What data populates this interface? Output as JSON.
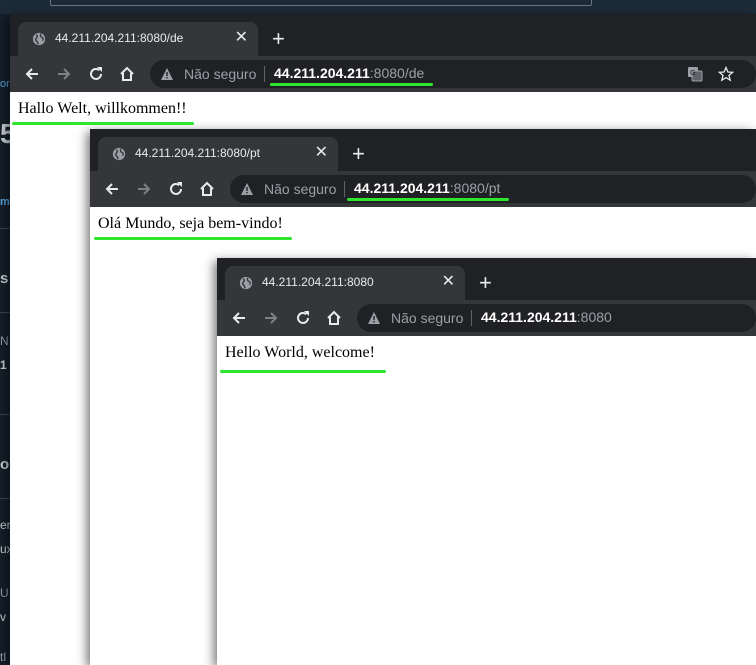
{
  "colors": {
    "highlight": "#2ee62e",
    "tabstrip": "#202124",
    "tab": "#35363a",
    "omnibox": "#202124"
  },
  "background_app": {
    "fragments": [
      "or",
      "5",
      "m",
      "s",
      "N",
      "1",
      "or",
      "er",
      "ux",
      "U",
      "v",
      "tl"
    ]
  },
  "windows": [
    {
      "tab_title": "44.211.204.211:8080/de",
      "close_glyph": "✕",
      "newtab_glyph": "+",
      "security_label": "Não seguro",
      "url_host": "44.211.204.211",
      "url_rest": ":8080/de",
      "page_text": "Hallo Welt, willkommen!!",
      "icons": [
        "globe-icon",
        "close-icon",
        "plus-icon",
        "back-icon",
        "forward-icon",
        "reload-icon",
        "home-icon",
        "warning-icon",
        "translate-icon",
        "star-icon"
      ]
    },
    {
      "tab_title": "44.211.204.211:8080/pt",
      "close_glyph": "✕",
      "newtab_glyph": "+",
      "security_label": "Não seguro",
      "url_host": "44.211.204.211",
      "url_rest": ":8080/pt",
      "page_text": "Olá Mundo, seja bem-vindo!",
      "icons": [
        "globe-icon",
        "close-icon",
        "plus-icon",
        "back-icon",
        "forward-icon",
        "reload-icon",
        "home-icon",
        "warning-icon"
      ]
    },
    {
      "tab_title": "44.211.204.211:8080",
      "close_glyph": "✕",
      "newtab_glyph": "+",
      "security_label": "Não seguro",
      "url_host": "44.211.204.211",
      "url_rest": ":8080",
      "page_text": "Hello World, welcome!",
      "icons": [
        "globe-icon",
        "close-icon",
        "plus-icon",
        "back-icon",
        "forward-icon",
        "reload-icon",
        "home-icon",
        "warning-icon"
      ]
    }
  ]
}
